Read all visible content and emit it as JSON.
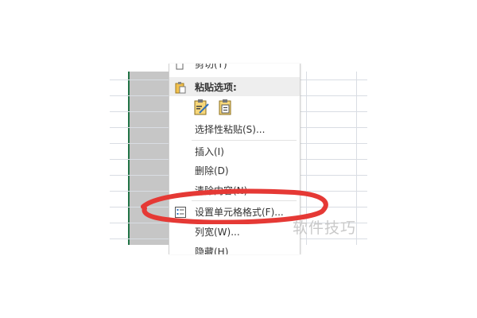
{
  "context_menu": {
    "items": [
      {
        "label": "剪切(T)",
        "icon": "cut-icon"
      },
      {
        "label": "粘贴选项:",
        "icon": "paste-clipboard-icon",
        "header": true
      },
      {
        "label": "",
        "icon": "paste-options-icons"
      },
      {
        "label": "选择性粘贴(S)...",
        "icon": ""
      },
      {
        "label": "插入(I)",
        "icon": ""
      },
      {
        "label": "删除(D)",
        "icon": ""
      },
      {
        "label": "清除内容(N)",
        "icon": ""
      },
      {
        "label": "设置单元格格式(F)...",
        "icon": "format-cells-icon"
      },
      {
        "label": "列宽(W)...",
        "icon": ""
      },
      {
        "label": "隐藏(H)",
        "icon": ""
      }
    ]
  },
  "watermark": "软件技巧",
  "colors": {
    "selection_column": "#c6c6c6",
    "selection_border": "#217346",
    "highlight_ring": "#e53935"
  }
}
